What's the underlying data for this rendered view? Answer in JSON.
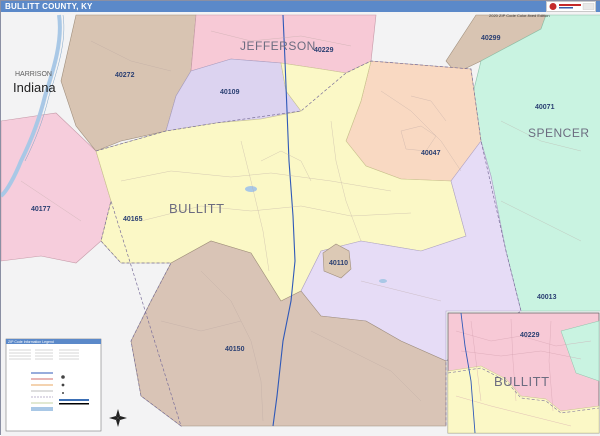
{
  "header": {
    "title": "BULLITT COUNTY, KY",
    "edition": "2020 ZIP Code Color-fixed Edition"
  },
  "colors": {
    "title_bar": "#5b89c9",
    "water": "#a9c8e6",
    "zip_40272": "#d8c4b2",
    "zip_40177": "#f6cddc",
    "zip_40165": "#fbf8c6",
    "zip_40109": "#dcd3f0",
    "zip_40229": "#f7c9d6",
    "zip_40299": "#d8c4b2",
    "zip_40071": "#c9f3e1",
    "zip_40047": "#f9d9c2",
    "zip_40110": "#dcc9b5",
    "zip_40013": "#e6dcf6",
    "zip_40150": "#d9c4b6"
  },
  "map": {
    "region_labels": [
      {
        "id": "harrison",
        "text": "HARRISON"
      },
      {
        "id": "indiana",
        "text": "Indiana"
      },
      {
        "id": "jefferson",
        "text": "JEFFERSON"
      },
      {
        "id": "spencer",
        "text": "SPENCER"
      },
      {
        "id": "bullitt",
        "text": "BULLITT"
      }
    ],
    "zip_labels": [
      "40272",
      "40229",
      "40299",
      "40109",
      "40071",
      "40047",
      "40177",
      "40165",
      "40110",
      "40013",
      "40150"
    ]
  },
  "inset": {
    "zip_label": "40229",
    "county_label": "BULLITT"
  },
  "legend": {
    "title": "ZIP Code Information Legend",
    "compass_icon": "compass-rose-icon"
  }
}
